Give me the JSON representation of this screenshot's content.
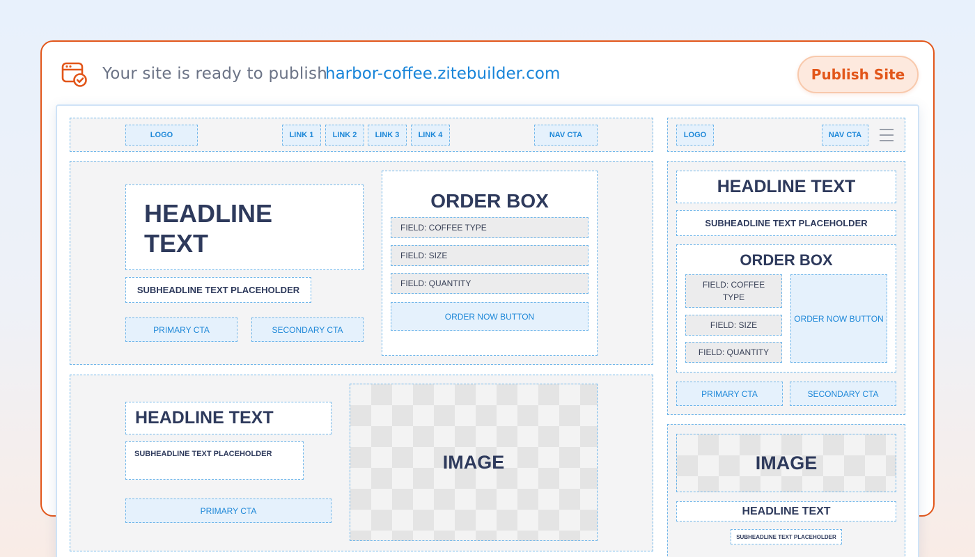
{
  "status_bar": {
    "message": "Your site is ready to publish",
    "url": "harbor-coffee.zitebuilder.com",
    "publish_label": "Publish Site"
  },
  "desktop": {
    "nav": {
      "logo": "LOGO",
      "links": [
        "LINK 1",
        "LINK 2",
        "LINK 3",
        "LINK 4"
      ],
      "cta": "NAV CTA"
    },
    "hero": {
      "headline_line1": "HEADLINE",
      "headline_line2": "TEXT",
      "subheadline": "SUBHEADLINE TEXT PLACEHOLDER",
      "primary_cta": "PRIMARY CTA",
      "secondary_cta": "SECONDARY CTA",
      "order_box": {
        "title": "ORDER BOX",
        "fields": [
          "FIELD: COFFEE TYPE",
          "FIELD: SIZE",
          "FIELD: QUANTITY"
        ],
        "button": "ORDER NOW BUTTON"
      }
    },
    "feature": {
      "headline": "HEADLINE TEXT",
      "subheadline": "SUBHEADLINE TEXT PLACEHOLDER",
      "primary_cta": "PRIMARY CTA",
      "image": "IMAGE"
    }
  },
  "mobile": {
    "nav": {
      "logo": "LOGO",
      "cta": "NAV CTA"
    },
    "hero": {
      "headline": "HEADLINE TEXT",
      "subheadline": "SUBHEADLINE TEXT PLACEHOLDER",
      "order_box": {
        "title": "ORDER BOX",
        "field_coffee_line1": "FIELD: COFFEE",
        "field_coffee_line2": "TYPE",
        "field_size": "FIELD: SIZE",
        "field_quantity": "FIELD: QUANTITY",
        "button": "ORDER NOW BUTTON"
      },
      "primary_cta": "PRIMARY CTA",
      "secondary_cta": "SECONDARY CTA"
    },
    "feature": {
      "image": "IMAGE",
      "headline": "HEADLINE TEXT",
      "subheadline": "SUBHEADLINE TEXT PLACEHOLDER"
    }
  },
  "colors": {
    "accent_orange": "#e2561a",
    "link_blue": "#1784d9",
    "headline_navy": "#2e3a5c",
    "placeholder_blue": "#e5f1fc"
  }
}
